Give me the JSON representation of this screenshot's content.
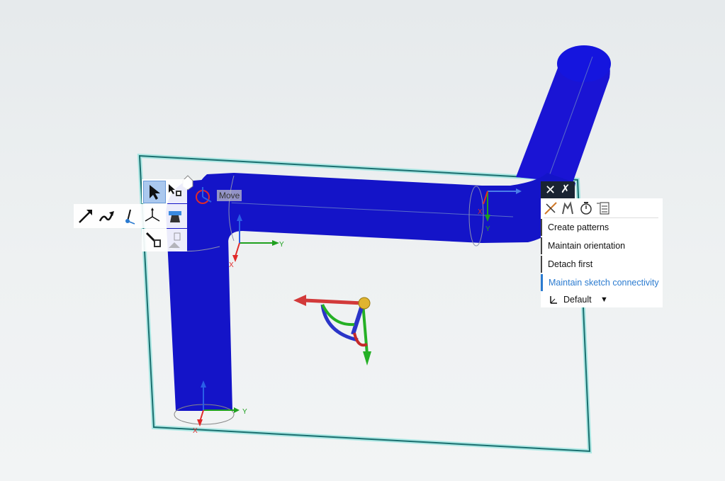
{
  "viewport": {
    "move_label": "Move",
    "axis_labels": {
      "x": "X",
      "y": "Y"
    }
  },
  "left_toolbar": {
    "tools": [
      {
        "name": "select-tool-icon",
        "selected": true
      },
      {
        "name": "select-body-icon"
      },
      {
        "name": "move-along-path-icon"
      },
      {
        "name": "path-curve-icon"
      },
      {
        "name": "anchor-point-icon"
      },
      {
        "name": "move-axes-icon"
      },
      {
        "name": "ruler-measure-icon"
      },
      {
        "name": "fold-icon"
      },
      {
        "name": "select-component-icon"
      }
    ]
  },
  "options_panel": {
    "icons": [
      "ruler-dimension-icon",
      "snap-icon",
      "timer-icon",
      "list-options-icon"
    ],
    "items": [
      {
        "label": "Create patterns",
        "active": false
      },
      {
        "label": "Maintain orientation",
        "active": false
      },
      {
        "label": "Detach first",
        "active": false
      },
      {
        "label": "Maintain sketch connectivity",
        "active": true
      }
    ],
    "dropdown": {
      "selected": "Default"
    }
  },
  "colors": {
    "body": "#1414c8",
    "plane_outline": "#1a6e6e",
    "plane_glow": "#8fe3dd",
    "axis_x": "#e02a2a",
    "axis_y": "#1fa01f",
    "axis_z": "#2a5fe6",
    "active": "#2b7bd0"
  }
}
